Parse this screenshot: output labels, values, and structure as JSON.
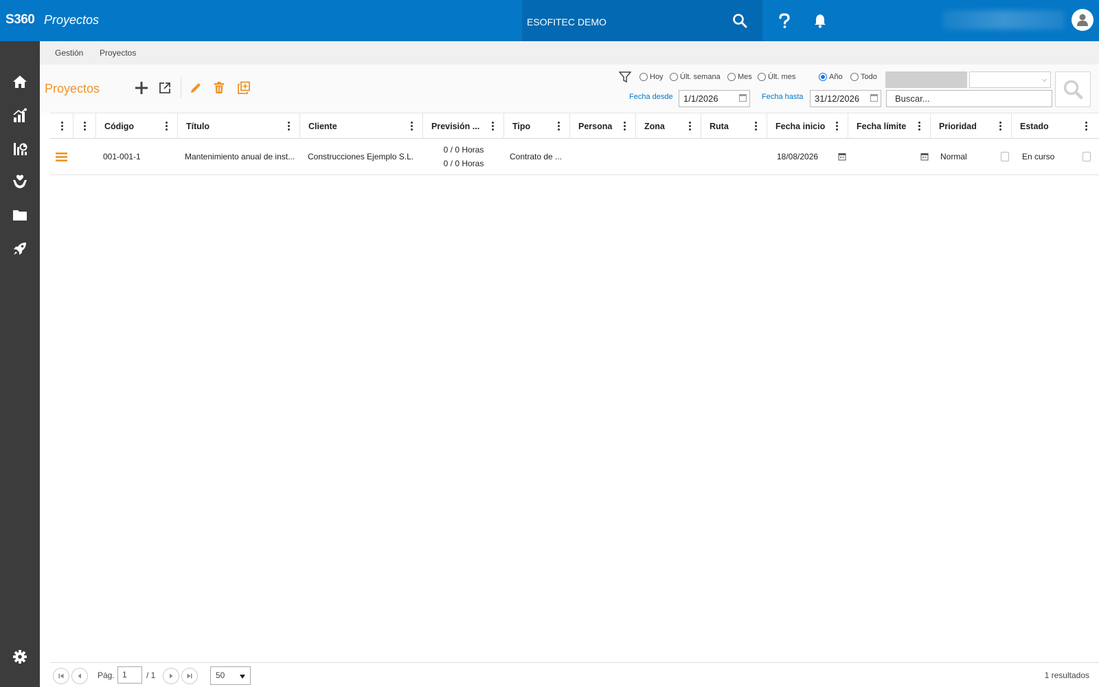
{
  "app": {
    "brand": "S360",
    "title": "Proyectos",
    "company": "ESOFITEC DEMO"
  },
  "topbar": {
    "icons": [
      "search-icon",
      "help-icon",
      "bell-icon",
      "avatar-icon"
    ]
  },
  "sidebar": {
    "items": [
      "home-icon",
      "chart-icon",
      "dashboard-icon",
      "hand-care-icon",
      "folder-icon",
      "rocket-icon"
    ],
    "bottom": "gear-icon"
  },
  "breadcrumb": {
    "items": [
      "Gestión",
      "Proyectos"
    ]
  },
  "toolbar": {
    "title": "Proyectos",
    "tools": [
      "plus-icon",
      "external-link-icon",
      "pencil-icon",
      "trash-icon",
      "duplicate-icon"
    ]
  },
  "filters": {
    "ranges": [
      "Hoy",
      "Últ. semana",
      "Mes",
      "Últ. mes",
      "Año",
      "Todo"
    ],
    "selected": "Año",
    "from_label": "Fecha desde",
    "from_value": "1/1/2026",
    "to_label": "Fecha hasta",
    "to_value": "31/12/2026",
    "search_placeholder": "Buscar..."
  },
  "grid": {
    "columns": [
      "Código",
      "Título",
      "Cliente",
      "Previsión ...",
      "Tipo",
      "Persona",
      "Zona",
      "Ruta",
      "Fecha inicio",
      "Fecha límite",
      "Prioridad",
      "Estado"
    ],
    "rows": [
      {
        "codigo": "001-001-1",
        "titulo": "Mantenimiento anual de inst...",
        "cliente": "Construcciones Ejemplo S.L.",
        "prevision_1": "0 / 0 Horas",
        "prevision_2": "0 / 0 Horas",
        "tipo": "Contrato de ...",
        "persona": "",
        "zona": "",
        "ruta": "",
        "fecha_inicio": "18/08/2026",
        "fecha_limite": "",
        "prioridad": "Normal",
        "estado": "En curso"
      }
    ]
  },
  "footer": {
    "page_label": "Pág.",
    "page_value": "1",
    "page_total": "/ 1",
    "page_size": "50",
    "results": "1 resultados"
  },
  "colors": {
    "primary": "#0477c6",
    "accent": "#f0932a",
    "sidebar": "#3c3c3c"
  }
}
